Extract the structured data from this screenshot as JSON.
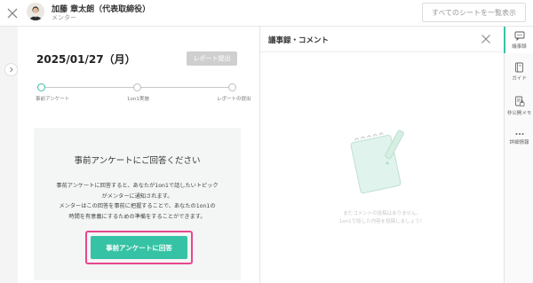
{
  "header": {
    "user_name": "加藤 章太朗（代表取締役）",
    "user_role": "メンター",
    "all_sheets_button": "すべてのシートを一覧表示"
  },
  "main": {
    "date": "2025/01/27（月）",
    "report_button": "レポート提出",
    "steps": [
      {
        "label": "事前アンケート",
        "active": true
      },
      {
        "label": "1on1実施",
        "active": false
      },
      {
        "label": "レポートの提出",
        "active": false
      }
    ],
    "survey": {
      "title": "事前アンケートにご回答ください",
      "desc_lines": [
        "事前アンケートに回答すると、あなたが1on1で話したいトピック",
        "がメンターに通知されます。",
        "メンターはこの回答を事前に把握することで、あなたの1on1の",
        "時間を有意義にするための準備をすることができます。"
      ],
      "cta_label": "事前アンケートに回答"
    }
  },
  "right_panel": {
    "title": "議事録・コメント",
    "empty_lines": [
      "まだコメントの投稿はありません。",
      "1on1で話した内容を投稿しましょう！"
    ]
  },
  "rail": [
    {
      "label": "議事録",
      "icon": "chat-icon",
      "active": true
    },
    {
      "label": "ガイド",
      "icon": "book-icon",
      "active": false
    },
    {
      "label": "非公開メモ",
      "icon": "lock-note-icon",
      "active": false
    },
    {
      "label": "詳細情報",
      "icon": "more-icon",
      "active": false
    }
  ],
  "colors": {
    "accent": "#35c2a5",
    "highlight": "#e8478c",
    "disabled": "#cfcfcf"
  }
}
